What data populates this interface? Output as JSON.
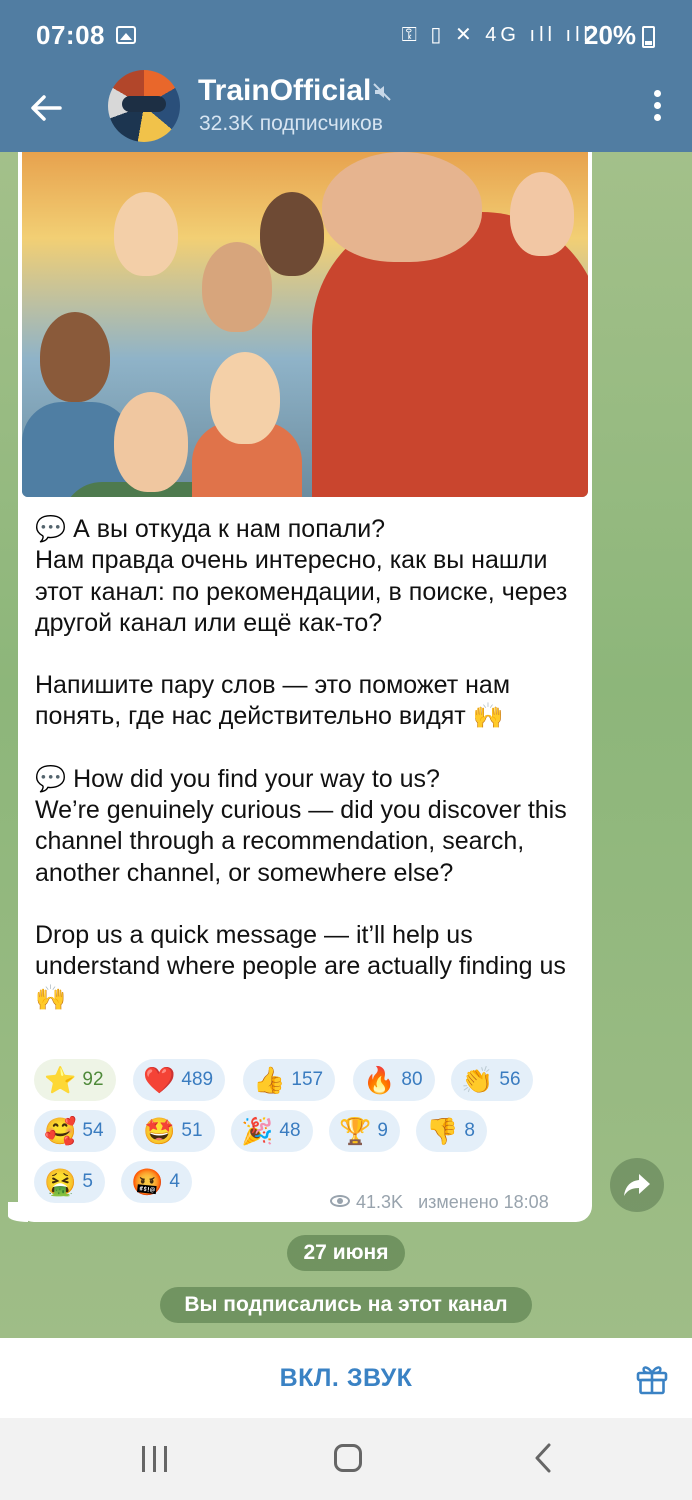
{
  "status_bar": {
    "time": "07:08",
    "icons": "⚿ ▯ ✕ 4G ıll ıll",
    "battery": "20%"
  },
  "header": {
    "title": "TrainOfficial",
    "subscribers": "32.3K подписчиков"
  },
  "message": {
    "paragraphs": [
      "💬 А вы откуда к нам попали?\nНам правда очень интересно, как вы нашли этот канал: по рекомендации, в поиске, через другой канал или ещё как-то?",
      "Напишите пару слов — это поможет нам понять, где нас действительно видят 🙌",
      "💬 How did you find your way to us?\nWe’re genuinely curious — did you discover this channel through a recommendation, search, another channel, or somewhere else?",
      "Drop us a quick message — it’ll help us understand where people are actually finding us 🙌"
    ],
    "reactions": [
      {
        "emoji": "⭐",
        "count": "92"
      },
      {
        "emoji": "❤️",
        "count": "489"
      },
      {
        "emoji": "👍",
        "count": "157"
      },
      {
        "emoji": "🔥",
        "count": "80"
      },
      {
        "emoji": "👏",
        "count": "56"
      },
      {
        "emoji": "🥰",
        "count": "54"
      },
      {
        "emoji": "🤩",
        "count": "51"
      },
      {
        "emoji": "🎉",
        "count": "48"
      },
      {
        "emoji": "🏆",
        "count": "9"
      },
      {
        "emoji": "👎",
        "count": "8"
      },
      {
        "emoji": "🤮",
        "count": "5"
      },
      {
        "emoji": "🤬",
        "count": "4"
      }
    ],
    "views": "41.3K",
    "edited": "изменено 18:08"
  },
  "date_pill": "27 июня",
  "service_message": "Вы подписались на этот канал",
  "bottom_bar": {
    "unmute_label": "ВКЛ. ЗВУК"
  },
  "colors": {
    "header": "#517da2",
    "accent": "#3a82c4",
    "chat_bg": "#8fb27a"
  }
}
